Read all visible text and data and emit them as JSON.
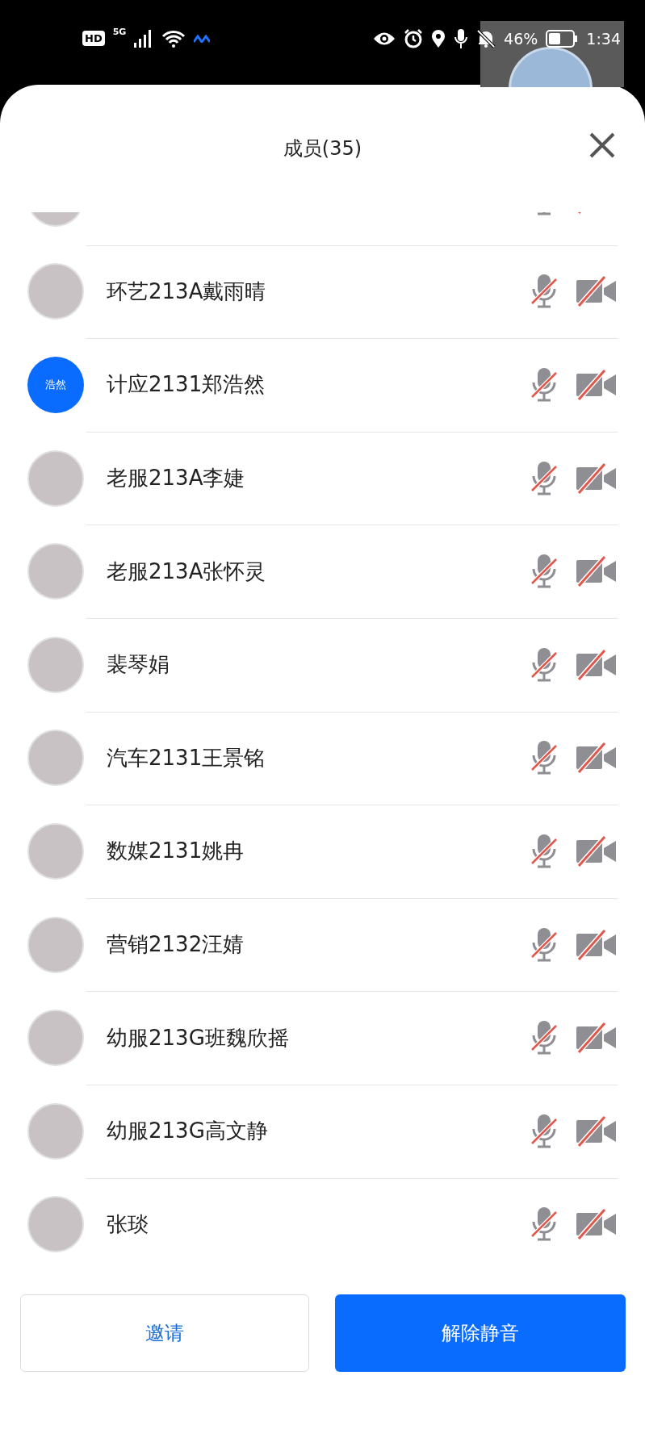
{
  "status_bar": {
    "left": [
      "HD",
      "5G"
    ],
    "battery": "46%",
    "time": "1:34"
  },
  "sheet": {
    "title": "成员(35)"
  },
  "members": [
    {
      "kind": "photo",
      "mic_muted": true,
      "camera_off": true,
      "partial": true
    },
    {
      "name": "环艺213A戴雨晴",
      "kind": "photo",
      "mic_muted": true,
      "camera_off": true,
      "partial": false
    },
    {
      "name": "计应2131郑浩然",
      "kind": "text",
      "avatar_text": "浩然",
      "color": "#0a6cff",
      "mic_muted": true,
      "camera_off": true,
      "partial": false
    },
    {
      "name": "老服213A李婕",
      "kind": "photo",
      "mic_muted": true,
      "camera_off": true,
      "partial": false
    },
    {
      "name": "老服213A张怀灵",
      "kind": "photo",
      "mic_muted": true,
      "camera_off": true,
      "partial": false
    },
    {
      "name": "裴琴娟",
      "kind": "photo",
      "mic_muted": true,
      "camera_off": true,
      "partial": false
    },
    {
      "name": "汽车2131王景铭",
      "kind": "photo",
      "mic_muted": true,
      "camera_off": true,
      "partial": false
    },
    {
      "name": "数媒2131姚冉",
      "kind": "photo",
      "mic_muted": true,
      "camera_off": true,
      "partial": false
    },
    {
      "name": "营销2132汪婧",
      "kind": "photo",
      "mic_muted": true,
      "camera_off": true,
      "partial": false
    },
    {
      "name": "幼服213G班魏欣摇",
      "kind": "photo",
      "mic_muted": true,
      "camera_off": true,
      "partial": false
    },
    {
      "name": "幼服213G高文静",
      "kind": "photo",
      "mic_muted": true,
      "camera_off": true,
      "partial": false
    },
    {
      "name": "张琰",
      "kind": "photo",
      "mic_muted": true,
      "camera_off": true,
      "partial": false
    }
  ],
  "buttons": [
    {
      "label": "邀请",
      "kind": "secondary"
    },
    {
      "label": "解除静音",
      "kind": "primary"
    }
  ]
}
